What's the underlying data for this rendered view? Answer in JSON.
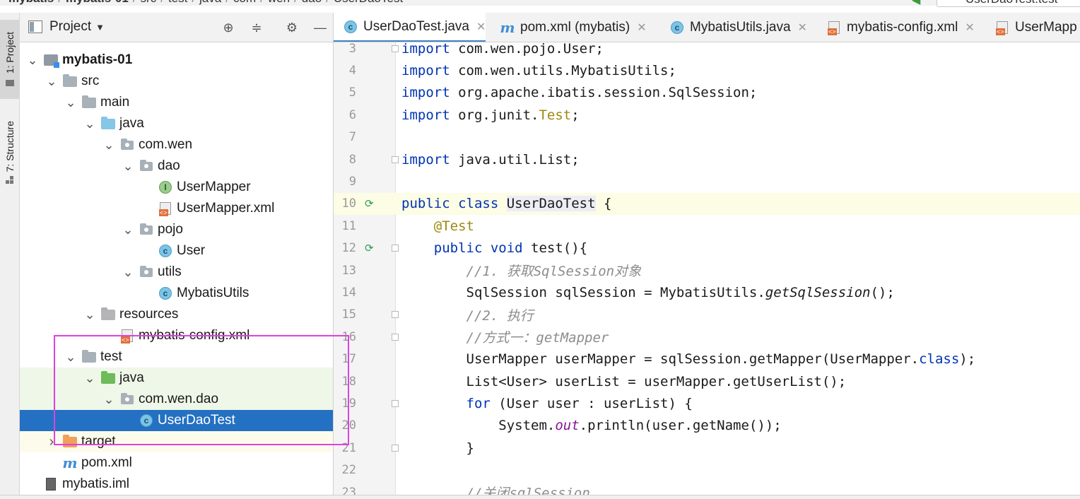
{
  "breadcrumb": [
    "mybatis",
    "mybatis-01",
    "src",
    "test",
    "java",
    "com",
    "wen",
    "dao",
    "UserDaoTest"
  ],
  "run_config": "UserDaoTest.test",
  "tool_stripe": {
    "project_label": "1: Project",
    "structure_label": "7: Structure"
  },
  "project_panel": {
    "title": "Project"
  },
  "tree": [
    {
      "label": "mybatis-01",
      "depth": 1,
      "arrow": "down",
      "icon": "module",
      "bold": true
    },
    {
      "label": "src",
      "depth": 2,
      "arrow": "down",
      "icon": "folder"
    },
    {
      "label": "main",
      "depth": 3,
      "arrow": "down",
      "icon": "folder"
    },
    {
      "label": "java",
      "depth": 4,
      "arrow": "down",
      "icon": "folder-blue"
    },
    {
      "label": "com.wen",
      "depth": 5,
      "arrow": "down",
      "icon": "package"
    },
    {
      "label": "dao",
      "depth": 6,
      "arrow": "down",
      "icon": "package"
    },
    {
      "label": "UserMapper",
      "depth": 7,
      "arrow": "",
      "icon": "interface"
    },
    {
      "label": "UserMapper.xml",
      "depth": 7,
      "arrow": "",
      "icon": "xml"
    },
    {
      "label": "pojo",
      "depth": 6,
      "arrow": "down",
      "icon": "package"
    },
    {
      "label": "User",
      "depth": 7,
      "arrow": "",
      "icon": "class"
    },
    {
      "label": "utils",
      "depth": 6,
      "arrow": "down",
      "icon": "package"
    },
    {
      "label": "MybatisUtils",
      "depth": 7,
      "arrow": "",
      "icon": "class"
    },
    {
      "label": "resources",
      "depth": 4,
      "arrow": "down",
      "icon": "folder-res"
    },
    {
      "label": "mybatis-config.xml",
      "depth": 5,
      "arrow": "",
      "icon": "xml",
      "strike": true
    },
    {
      "label": "test",
      "depth": 3,
      "arrow": "down",
      "icon": "folder"
    },
    {
      "label": "java",
      "depth": 4,
      "arrow": "down",
      "icon": "folder-green",
      "bg": "green"
    },
    {
      "label": "com.wen.dao",
      "depth": 5,
      "arrow": "down",
      "icon": "package",
      "bg": "green"
    },
    {
      "label": "UserDaoTest",
      "depth": 6,
      "arrow": "",
      "icon": "class",
      "bg": "selected"
    },
    {
      "label": "target",
      "depth": 2,
      "arrow": "right",
      "icon": "folder-orange",
      "bg": "cream"
    },
    {
      "label": "pom.xml",
      "depth": 2,
      "arrow": "",
      "icon": "maven"
    },
    {
      "label": "mybatis.iml",
      "depth": 1,
      "arrow": "",
      "icon": "iml"
    }
  ],
  "tabs": [
    {
      "label": "UserDaoTest.java",
      "icon": "class",
      "active": true
    },
    {
      "label": "pom.xml (mybatis)",
      "icon": "maven"
    },
    {
      "label": "MybatisUtils.java",
      "icon": "class"
    },
    {
      "label": "mybatis-config.xml",
      "icon": "xml"
    },
    {
      "label": "UserMapp",
      "icon": "xml"
    }
  ],
  "code_lines": [
    {
      "n": "3",
      "html": "<span class=\"kw\">import</span> com.wen.pojo.User;",
      "fold": true
    },
    {
      "n": "4",
      "html": "<span class=\"kw\">import</span> com.wen.utils.MybatisUtils;"
    },
    {
      "n": "5",
      "html": "<span class=\"kw\">import</span> org.apache.ibatis.session.SqlSession;"
    },
    {
      "n": "6",
      "html": "<span class=\"kw\">import</span> org.junit.<span class=\"ann\">Test</span>;"
    },
    {
      "n": "7",
      "html": ""
    },
    {
      "n": "8",
      "html": "<span class=\"kw\">import</span> java.util.List;",
      "fold": true
    },
    {
      "n": "9",
      "html": ""
    },
    {
      "n": "10",
      "html": "<span class=\"kw\">public class</span> <span class=\"cls-hl\">UserDaoTest</span> {",
      "run": true,
      "current": true
    },
    {
      "n": "11",
      "html": "    <span class=\"ann\">@Test</span>"
    },
    {
      "n": "12",
      "html": "    <span class=\"kw\">public void</span> test(){",
      "run": true,
      "fold": true
    },
    {
      "n": "13",
      "html": "        <span class=\"cmt\">//1. 获取SqlSession对象</span>"
    },
    {
      "n": "14",
      "html": "        SqlSession sqlSession = MybatisUtils.<span class=\"italic\">getSqlSession</span>();"
    },
    {
      "n": "15",
      "html": "        <span class=\"cmt\">//2. 执行</span>",
      "fold": true
    },
    {
      "n": "16",
      "html": "        <span class=\"cmt\">//方式一：getMapper</span>",
      "fold": true
    },
    {
      "n": "17",
      "html": "        UserMapper userMapper = sqlSession.getMapper(UserMapper.<span class=\"kw\">class</span>);"
    },
    {
      "n": "18",
      "html": "        List&lt;User&gt; userList = userMapper.getUserList();"
    },
    {
      "n": "19",
      "html": "        <span class=\"kw\">for</span> (User user : userList) {",
      "fold": true
    },
    {
      "n": "20",
      "html": "            System.<span class=\"field\">out</span>.println(user.getName());"
    },
    {
      "n": "21",
      "html": "        }",
      "fold": true
    },
    {
      "n": "22",
      "html": ""
    },
    {
      "n": "23",
      "html": "        <span class=\"cmt\">//关闭sqlSession</span>"
    }
  ]
}
